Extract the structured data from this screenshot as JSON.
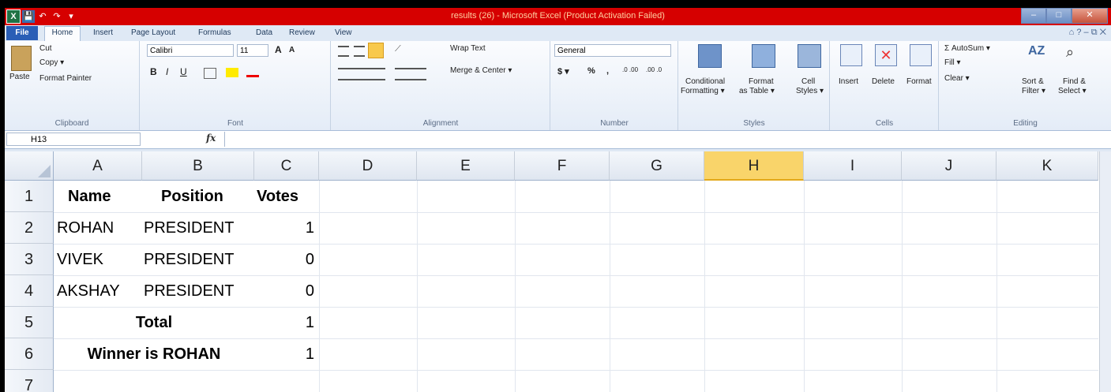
{
  "window": {
    "title": "results (26)  -  Microsoft Excel (Product Activation Failed)",
    "quick_access": [
      "X",
      "💾",
      "↶",
      "↷",
      "▾"
    ],
    "controls": {
      "minimize": "–",
      "maximize": "□",
      "close": "✕"
    }
  },
  "tabs": [
    "File",
    "Home",
    "Insert",
    "Page Layout",
    "Formulas",
    "Data",
    "Review",
    "View"
  ],
  "tab_right_icons": "⌂ ? – ⧉ ✕",
  "ribbon": {
    "clipboard": {
      "label": "Clipboard",
      "paste": "Paste",
      "cut": "Cut",
      "copy": "Copy ▾",
      "format_painter": "Format Painter"
    },
    "font": {
      "label": "Font",
      "name": "Calibri",
      "size": "11",
      "bold": "B",
      "italic": "I",
      "underline": "U",
      "grow": "A",
      "shrink": "A"
    },
    "alignment": {
      "label": "Alignment",
      "wrap_text": "Wrap Text",
      "merge_center": "Merge & Center ▾"
    },
    "number": {
      "label": "Number",
      "format": "General",
      "currency": "$ ▾",
      "percent": "%",
      "comma": ",",
      "inc_dec": ".0 .00",
      "dec_dec": ".00 .0"
    },
    "styles": {
      "label": "Styles",
      "conditional": "Conditional",
      "conditional2": "Formatting ▾",
      "format_table": "Format",
      "format_table2": "as Table ▾",
      "cell_styles": "Cell",
      "cell_styles2": "Styles ▾"
    },
    "cells": {
      "label": "Cells",
      "insert": "Insert",
      "delete": "Delete",
      "format": "Format"
    },
    "editing": {
      "label": "Editing",
      "autosum": "Σ AutoSum ▾",
      "fill": "Fill ▾",
      "clear": "Clear ▾",
      "sort": "Sort &",
      "sort2": "Filter ▾",
      "find": "Find &",
      "find2": "Select ▾"
    }
  },
  "formula_bar": {
    "name_box": "H13",
    "fx": "fx",
    "content": ""
  },
  "columns": [
    "A",
    "B",
    "C",
    "D",
    "E",
    "F",
    "G",
    "H",
    "I",
    "J",
    "K"
  ],
  "selected_column": "H",
  "rows": [
    "1",
    "2",
    "3",
    "4",
    "5",
    "6",
    "7"
  ],
  "cells": {
    "r1": {
      "a": "Name",
      "b": "Position",
      "c": "Votes"
    },
    "r2": {
      "a": "ROHAN",
      "b": "PRESIDENT",
      "c": "1"
    },
    "r3": {
      "a": "VIVEK",
      "b": "PRESIDENT",
      "c": "0"
    },
    "r4": {
      "a": "AKSHAY",
      "b": "PRESIDENT",
      "c": "0"
    },
    "r5": {
      "ab": "Total",
      "c": "1"
    },
    "r6": {
      "ab": "Winner is ROHAN",
      "c": "1"
    }
  },
  "colors": {
    "title_bar": "#d60000",
    "selected_header": "#f9d46a",
    "file_tab": "#2a5eb6"
  }
}
